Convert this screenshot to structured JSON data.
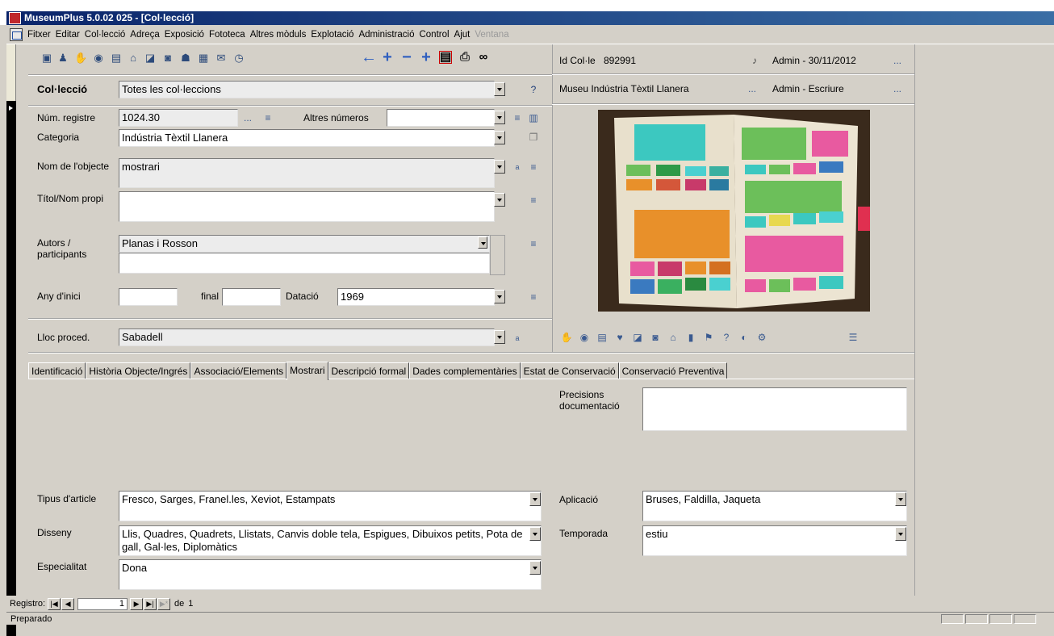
{
  "window": {
    "title": "MuseumPlus 5.0.02 025 - [Col·lecció]"
  },
  "menu": [
    "Fitxer",
    "Editar",
    "Col·lecció",
    "Adreça",
    "Exposició",
    "Fototeca",
    "Altres mòduls",
    "Explotació",
    "Administració",
    "Control",
    "Ajut",
    "Ventana"
  ],
  "toolbar": {
    "icons_left": [
      "record-icon",
      "person-icon",
      "handshake-icon",
      "eye-icon",
      "document-icon",
      "building-icon",
      "chart-icon",
      "camera-icon",
      "people-icon",
      "calendar-icon",
      "envelope-icon",
      "clock-icon"
    ],
    "nav_icons": [
      "arrow-left-icon",
      "plus-icon",
      "minus-icon",
      "plus-icon",
      "form-icon",
      "print-icon",
      "binoculars-icon"
    ]
  },
  "header": {
    "id_label": "Id Col·le",
    "id_value": "892991",
    "admin_date": "Admin - 30/11/2012",
    "museum": "Museu Indústria Tèxtil Llanera",
    "admin_write": "Admin - Escriure",
    "dots": "..."
  },
  "fields": {
    "coleccio_label": "Col·lecció",
    "coleccio_value": "Totes les col·leccions",
    "num_registre_label": "Núm. registre",
    "num_registre_value": "1024.30",
    "altres_numeros_label": "Altres números",
    "categoria_label": "Categoria",
    "categoria_value": "Indústria Tèxtil Llanera",
    "nom_objecte_label": "Nom de l'objecte",
    "nom_objecte_value": "mostrari",
    "titol_label": "Títol/Nom propi",
    "autors_label": "Autors / participants",
    "autors_value": "Planas i  Rosson",
    "any_inici_label": "Any d'inici",
    "final_label": "final",
    "datacio_label": "Datació",
    "datacio_value": "1969",
    "lloc_label": "Lloc proced.",
    "lloc_value": "Sabadell"
  },
  "tabs": [
    "Identificació",
    "Història Objecte/Ingrés",
    "Associació/Elements",
    "Mostrari",
    "Descripció formal",
    "Dades complementàries",
    "Estat de Conservació",
    "Conservació Preventiva"
  ],
  "active_tab": "Mostrari",
  "mostrari": {
    "precisions_label": "Precisions documentació",
    "tipus_label": "Tipus d'article",
    "tipus_value": "Fresco, Sarges, Franel.les, Xeviot, Estampats",
    "disseny_label": "Disseny",
    "disseny_value": "Llis, Quadres, Quadrets, Llistats, Canvis doble tela, Espigues, Dibuixos petits, Pota de gall, Gal·les, Diplomàtics",
    "especialitat_label": "Especialitat",
    "especialitat_value": "Dona",
    "aplicacio_label": "Aplicació",
    "aplicacio_value": "Bruses, Faldilla, Jaqueta",
    "temporada_label": "Temporada",
    "temporada_value": "estiu"
  },
  "navigation": {
    "label": "Registro:",
    "current": "1",
    "of_label": "de",
    "total": "1"
  },
  "status": {
    "text": "Preparado"
  }
}
